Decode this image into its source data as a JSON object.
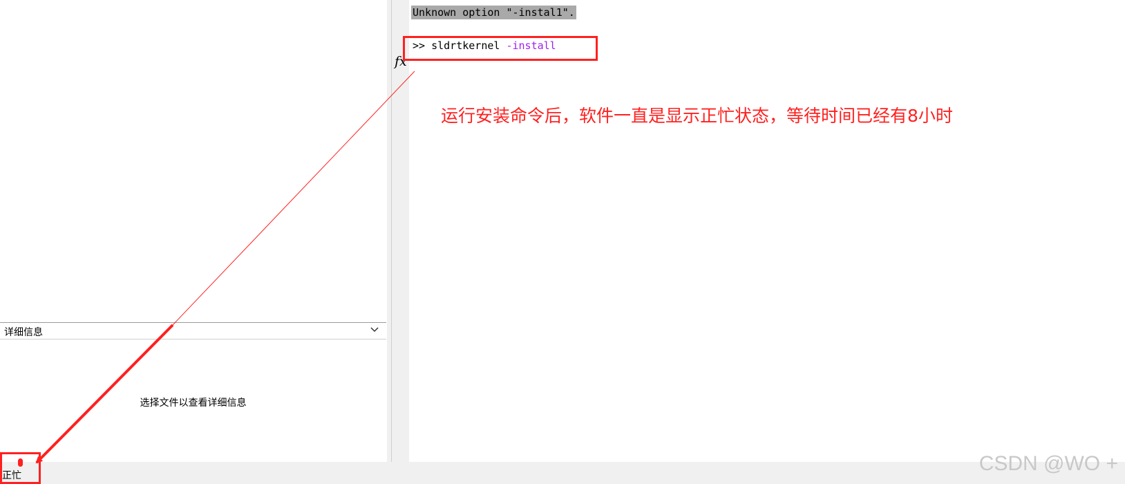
{
  "left_panel": {
    "details_header": "详细信息",
    "details_message": "选择文件以查看详细信息"
  },
  "command_window": {
    "output_line": "Unknown option \"-instal1\".",
    "prompt": ">> ",
    "command": "sldrtkernel ",
    "argument": "-install",
    "fx_icon": "fx"
  },
  "annotation": {
    "text": "运行安装命令后，软件一直是显示正忙状态，等待时间已经有8小时",
    "color": "#ff2020"
  },
  "status_bar": {
    "status": "正忙"
  },
  "watermark": "CSDN @WO +"
}
